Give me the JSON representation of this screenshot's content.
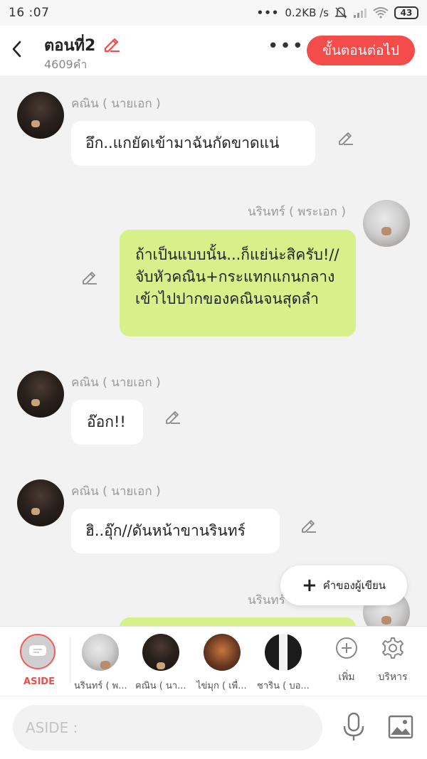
{
  "status_bar": {
    "time": "16 :07",
    "network_speed": "0.2KB /s",
    "battery": "43"
  },
  "header": {
    "title": "ตอนที่2",
    "word_count": "4609คำ",
    "next_button_label": "ขั้นตอนต่อไป"
  },
  "messages": [
    {
      "speaker": "คณิน ( นายเอก )",
      "text": "อึก..แกยัดเข้ามาฉันกัดขาดแน่",
      "side": "left"
    },
    {
      "speaker": "นรินทร์ ( พระเอก )",
      "text": "ถ้าเป็นแบบนั้น...ก็แย่น่ะสิครับ!//จับหัวคณิน+กระแทกแกนกลางเข้าไปปากของคณินจนสุดลำ",
      "side": "right"
    },
    {
      "speaker": "คณิน ( นายเอก )",
      "text": "อ๊อก!!",
      "side": "left"
    },
    {
      "speaker": "คณิน ( นายเอก )",
      "text": "ฮิ..อุ๊ก//ดันหน้าขานรินทร์",
      "side": "left"
    },
    {
      "speaker": "นรินทร์",
      "text": "",
      "side": "right"
    }
  ],
  "fab": {
    "label": "คำของผู้เขียน"
  },
  "character_bar": {
    "aside_label": "ASIDE",
    "characters": [
      {
        "name": "นรินทร์ ( พ..."
      },
      {
        "name": "คณิน ( นา..."
      },
      {
        "name": "ไข่มุก ( เพื่..."
      },
      {
        "name": "ชาริน ( บอ..."
      }
    ],
    "add_label": "เพิ่ม",
    "manage_label": "บริหาร"
  },
  "input": {
    "placeholder": "ASIDE :"
  },
  "colors": {
    "accent": "#f44b4b",
    "green_bubble": "#d7f08a",
    "background": "#f2f2f2"
  }
}
